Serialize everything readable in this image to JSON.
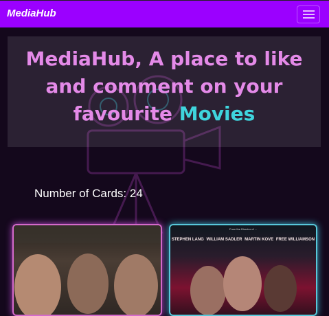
{
  "navbar": {
    "brand": "MediaHub"
  },
  "hero": {
    "text": "MediaHub, A place to like and comment on your favourite",
    "accent": "Movies"
  },
  "cards_count": {
    "label": "Number of Cards: 24"
  },
  "posters": [
    {
      "kind": "poster-soldiers",
      "credits": []
    },
    {
      "kind": "poster-crime",
      "tagline": "From the Director of ...",
      "credits": [
        "STEPHEN LANG",
        "WILLIAM SADLER",
        "MARTIN KOVE",
        "FREE WILLIAMSON"
      ]
    }
  ],
  "colors": {
    "navbar": "#9b00ff",
    "hero_text": "#e48ae8",
    "hero_accent": "#3fd4dd",
    "page_background": "#14081c"
  }
}
